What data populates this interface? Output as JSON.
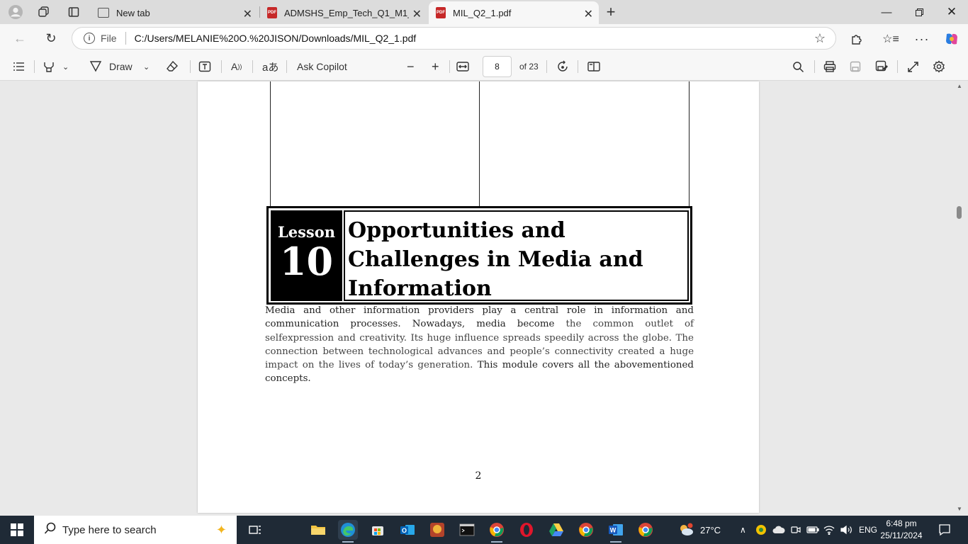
{
  "browser": {
    "tabs": [
      {
        "title": "New tab",
        "active": false
      },
      {
        "title": "ADMSHS_Emp_Tech_Q1_M1_L1-IC",
        "active": false
      },
      {
        "title": "MIL_Q2_1.pdf",
        "active": true
      }
    ],
    "address": {
      "scheme_label": "File",
      "url": "C:/Users/MELANIE%20O.%20JISON/Downloads/MIL_Q2_1.pdf"
    }
  },
  "pdf_toolbar": {
    "draw_label": "Draw",
    "ask_copilot_label": "Ask Copilot",
    "current_page": "8",
    "total_pages_label": "of 23"
  },
  "document": {
    "lesson_word": "Lesson",
    "lesson_number": "10",
    "lesson_title": "Opportunities and Challenges in Media and Information",
    "paragraph_part1": "Media and other information providers play a central role in information and communication processes. Nowadays, media become ",
    "paragraph_part2": "the common outlet of selfexpression and creativity. Its huge influence spreads speedily across the globe. The connection between technological advances and people’s connectivity created a huge impact on the lives of today’s generation.",
    "paragraph_part3": " This module covers all the abovementioned concepts.",
    "page_number": "2"
  },
  "taskbar": {
    "search_placeholder": "Type here to search",
    "weather": "27°C",
    "language": "ENG",
    "time": "6:48 pm",
    "date": "25/11/2024"
  }
}
